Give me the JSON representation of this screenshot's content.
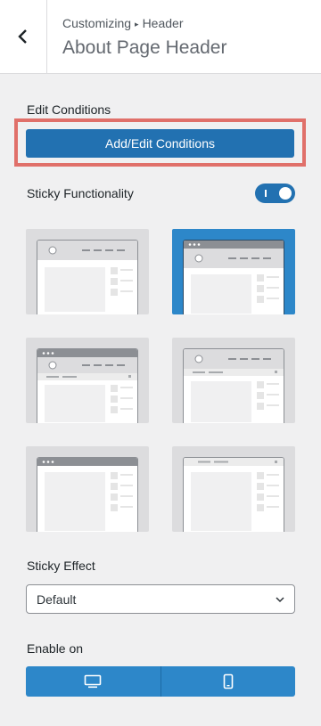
{
  "header": {
    "breadcrumb_root": "Customizing",
    "breadcrumb_separator": "▸",
    "breadcrumb_section": "Header",
    "title": "About Page Header"
  },
  "conditions": {
    "label": "Edit Conditions",
    "button_label": "Add/Edit Conditions"
  },
  "sticky": {
    "label": "Sticky Functionality",
    "enabled": true
  },
  "layouts": {
    "selected_index": 1,
    "count": 6
  },
  "sticky_effect": {
    "label": "Sticky Effect",
    "value": "Default"
  },
  "enable_on": {
    "label": "Enable on",
    "devices": [
      "desktop-icon",
      "mobile-icon"
    ]
  },
  "colors": {
    "accent": "#2271b1",
    "highlight": "#e0706a",
    "background": "#f0f0f1"
  }
}
